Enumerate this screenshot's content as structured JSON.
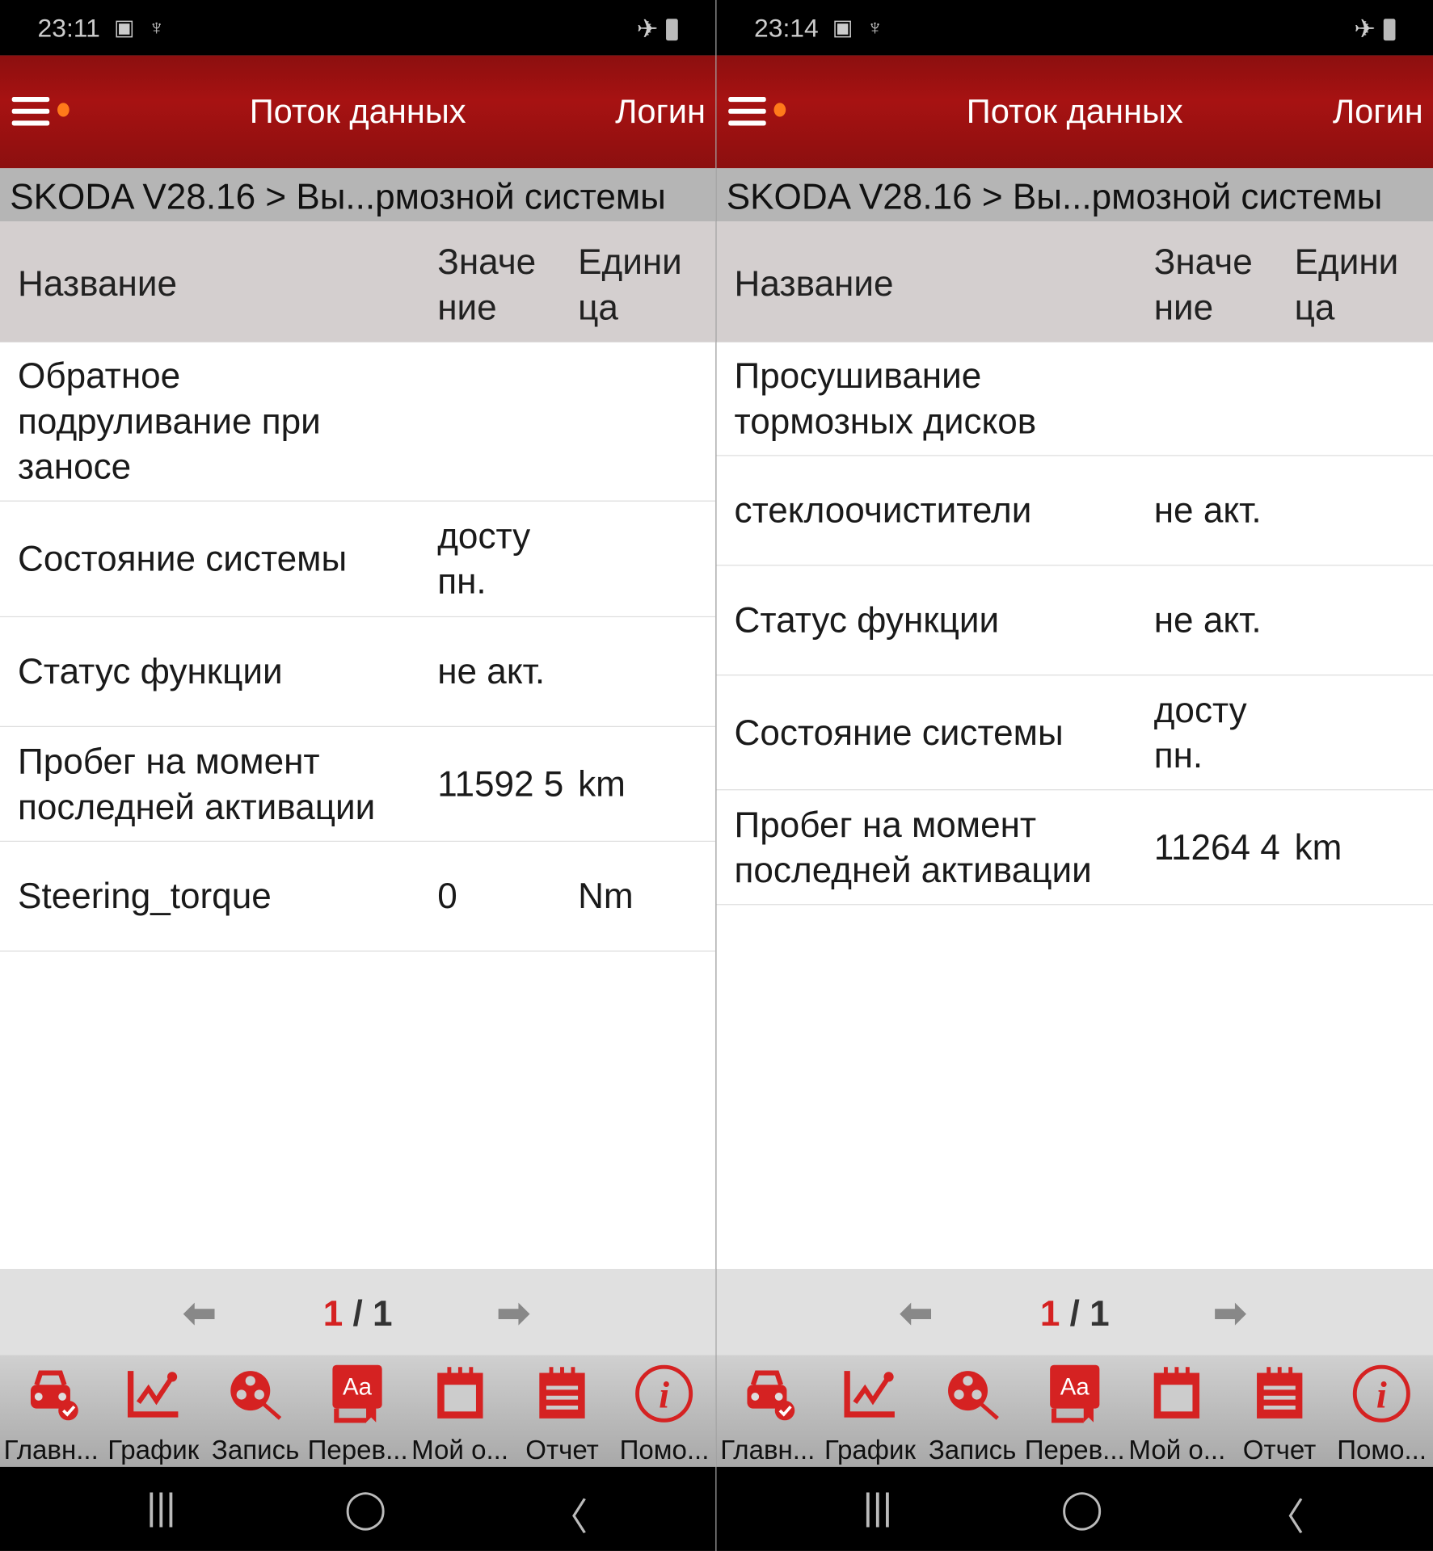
{
  "panels": [
    {
      "status": {
        "time": "23:11"
      },
      "header": {
        "title": "Поток данных",
        "login": "Логин"
      },
      "breadcrumb": "SKODA V28.16 > Вы...рмозной системы",
      "columns": {
        "name": "Название",
        "value": "Значе ние",
        "unit": "Едини ца"
      },
      "rows": [
        {
          "name": "Обратное подруливание при заносе",
          "value": "",
          "unit": ""
        },
        {
          "name": "Состояние системы",
          "value": "досту пн.",
          "unit": ""
        },
        {
          "name": "Статус функции",
          "value": "не акт.",
          "unit": ""
        },
        {
          "name": "Пробег на момент последней активации",
          "value": "11592 5",
          "unit": "km"
        },
        {
          "name": "Steering_torque",
          "value": "0",
          "unit": "Nm"
        }
      ],
      "pager": {
        "current": "1",
        "total": "/ 1"
      }
    },
    {
      "status": {
        "time": "23:14"
      },
      "header": {
        "title": "Поток данных",
        "login": "Логин"
      },
      "breadcrumb": "SKODA V28.16 > Вы...рмозной системы",
      "columns": {
        "name": "Название",
        "value": "Значе ние",
        "unit": "Едини ца"
      },
      "rows": [
        {
          "name": "Просушивание тормозных дисков",
          "value": "",
          "unit": ""
        },
        {
          "name": "стеклоочистители",
          "value": "не акт.",
          "unit": ""
        },
        {
          "name": "Статус функции",
          "value": "не акт.",
          "unit": ""
        },
        {
          "name": "Состояние системы",
          "value": "досту пн.",
          "unit": ""
        },
        {
          "name": "Пробег на момент последней активации",
          "value": "11264 4",
          "unit": "km"
        }
      ],
      "pager": {
        "current": "1",
        "total": "/ 1"
      }
    }
  ],
  "toolbar": [
    {
      "label": "Главн...",
      "icon": "car-check-icon"
    },
    {
      "label": "График",
      "icon": "graph-icon"
    },
    {
      "label": "Запись",
      "icon": "record-search-icon"
    },
    {
      "label": "Перев...",
      "icon": "translate-icon"
    },
    {
      "label": "Мой о...",
      "icon": "calendar-icon"
    },
    {
      "label": "Отчет",
      "icon": "report-icon"
    },
    {
      "label": "Помо...",
      "icon": "info-icon"
    }
  ],
  "colors": {
    "header": "#a71212",
    "accent": "#d52222"
  }
}
